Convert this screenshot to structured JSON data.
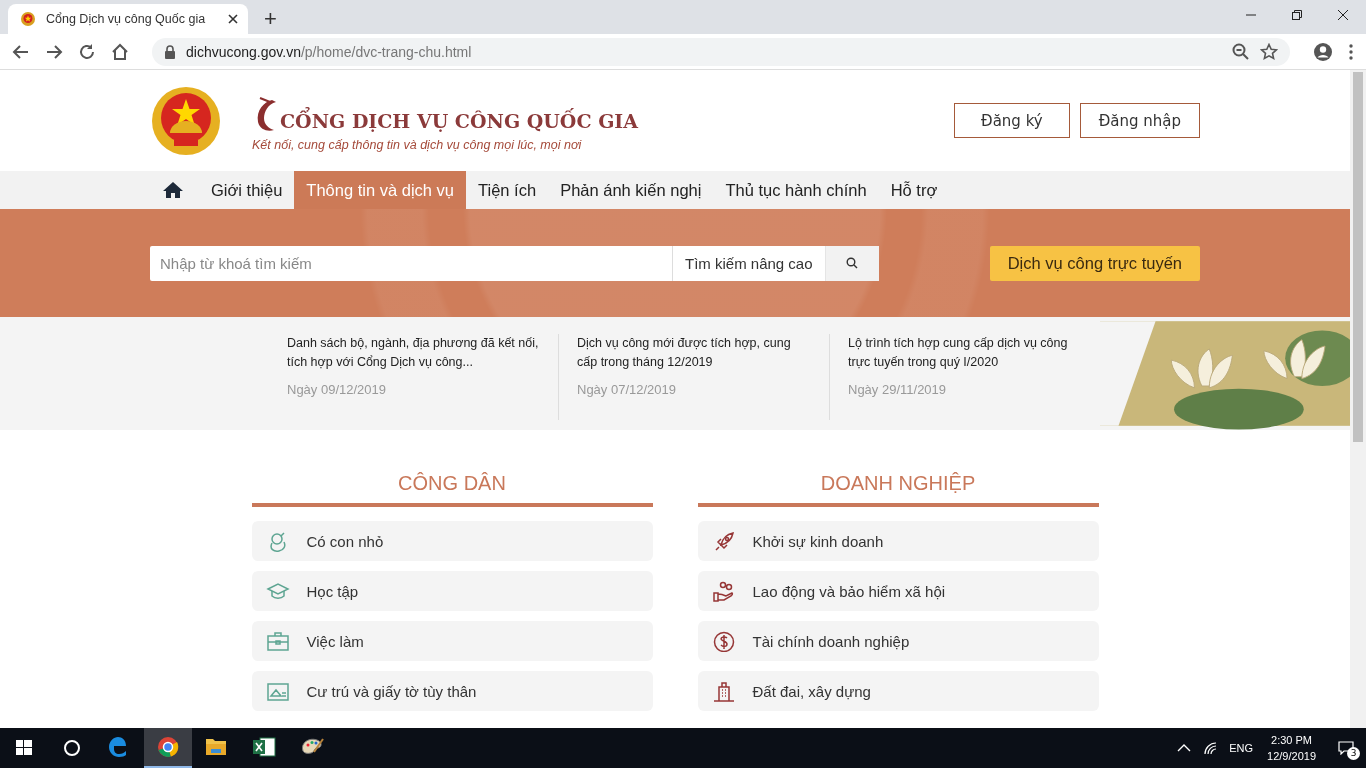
{
  "browser": {
    "tab_title": "Cổng Dịch vụ công Quốc gia",
    "new_tab": "+",
    "url_host": "dichvucong.gov.vn",
    "url_path": "/p/home/dvc-trang-chu.html"
  },
  "header": {
    "logo_title": "CỔNG DỊCH VỤ CÔNG QUỐC GIA",
    "slogan": "Kết nối, cung cấp thông tin và dịch vụ công mọi lúc, mọi nơi",
    "buttons": [
      "Đăng ký",
      "Đăng nhập"
    ]
  },
  "nav": [
    {
      "label": "Giới thiệu",
      "selected": false
    },
    {
      "label": "Thông tin và dịch vụ",
      "selected": true
    },
    {
      "label": "Tiện ích",
      "selected": false
    },
    {
      "label": "Phản ánh kiến nghị",
      "selected": false
    },
    {
      "label": "Thủ tục hành chính",
      "selected": false
    },
    {
      "label": "Hỗ trợ",
      "selected": false
    }
  ],
  "search": {
    "placeholder": "Nhập từ khoá tìm kiếm",
    "advanced": "Tìm kiếm nâng cao",
    "cta": "Dịch vụ công trực tuyến"
  },
  "news": [
    {
      "title": "Danh sách bộ, ngành, địa phương đã kết nối, tích hợp với Cổng Dịch vụ công...",
      "date": "Ngày 09/12/2019"
    },
    {
      "title": "Dịch vụ công mới được tích hợp, cung cấp trong tháng 12/2019",
      "date": "Ngày 07/12/2019"
    },
    {
      "title": "Lộ trình tích hợp cung cấp dịch vụ công trực tuyến trong quý I/2020",
      "date": "Ngày 29/11/2019"
    }
  ],
  "sections": [
    {
      "kind": "citizen",
      "title": "CÔNG DÂN",
      "items": [
        "Có con nhỏ",
        "Học tập",
        "Việc làm",
        "Cư trú và giấy tờ tùy thân"
      ]
    },
    {
      "kind": "business",
      "title": "DOANH NGHIỆP",
      "items": [
        "Khởi sự kinh doanh",
        "Lao động và bảo hiểm xã hội",
        "Tài chính doanh nghiệp",
        "Đất đai, xây dựng"
      ]
    }
  ],
  "taskbar": {
    "apps": [
      {
        "kind": "edge",
        "selected": false
      },
      {
        "kind": "chrome",
        "selected": true
      },
      {
        "kind": "folder",
        "selected": false
      },
      {
        "kind": "excel",
        "selected": false
      },
      {
        "kind": "paint",
        "selected": false
      }
    ],
    "language": "ENG",
    "time": "2:30 PM",
    "date": "12/9/2019",
    "notifications": "3"
  }
}
